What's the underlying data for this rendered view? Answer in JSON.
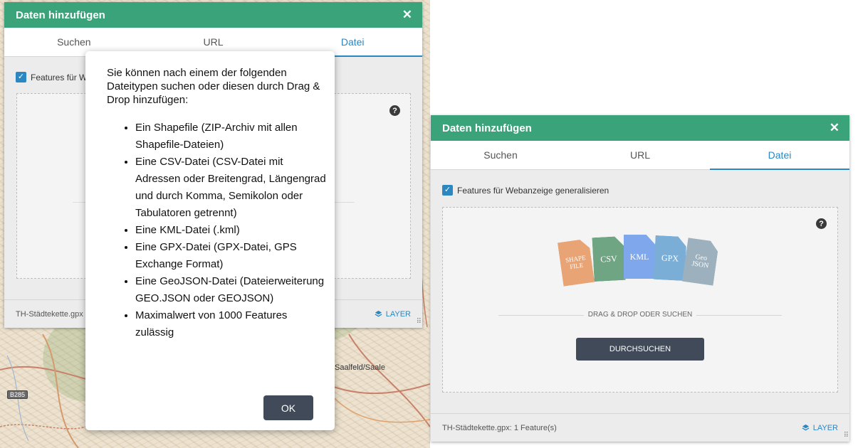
{
  "left": {
    "panel_title": "Daten hinzufügen",
    "tabs": [
      "Suchen",
      "URL",
      "Datei"
    ],
    "active_tab": "Datei",
    "checkbox_label_partial": "Features für W",
    "footer_text_partial": "TH-Städtekette.gpx",
    "layer_label": "LAYER",
    "map_labels": {
      "town": "Saalfeld/Saale",
      "road": "B285"
    },
    "modal": {
      "intro": "Sie können nach einem der folgenden Dateitypen suchen oder diesen durch Drag & Drop hinzufügen:",
      "items": [
        "Ein Shapefile (ZIP-Archiv mit allen Shapefile-Dateien)",
        "Eine CSV-Datei (CSV-Datei mit Adressen oder Breitengrad, Längengrad und durch Komma, Semikolon oder Tabulatoren getrennt)",
        "Eine KML-Datei (.kml)",
        "Eine GPX-Datei (GPX-Datei, GPS Exchange Format)",
        "Eine GeoJSON-Datei (Dateierweiterung GEO.JSON oder GEOJSON)",
        "Maximalwert von 1000 Features zulässig"
      ],
      "ok_label": "OK"
    }
  },
  "right": {
    "panel_title": "Daten hinzufügen",
    "tabs": [
      "Suchen",
      "URL",
      "Datei"
    ],
    "active_tab": "Datei",
    "checkbox_label": "Features für Webanzeige generalisieren",
    "file_types": [
      {
        "label": "SHAPE FILE",
        "color": "#e9a475"
      },
      {
        "label": "CSV",
        "color": "#6fa582"
      },
      {
        "label": "KML",
        "color": "#7fa8ec"
      },
      {
        "label": "GPX",
        "color": "#7aaed6"
      },
      {
        "label": "Geo JSON",
        "color": "#9db0be"
      }
    ],
    "drag_text": "DRAG & DROP ODER SUCHEN",
    "browse_label": "DURCHSUCHEN",
    "footer_text": "TH-Städtekette.gpx: 1 Feature(s)",
    "layer_label": "LAYER"
  },
  "colors": {
    "header": "#3aa37a",
    "accent": "#2a87c2",
    "button": "#404a59"
  }
}
